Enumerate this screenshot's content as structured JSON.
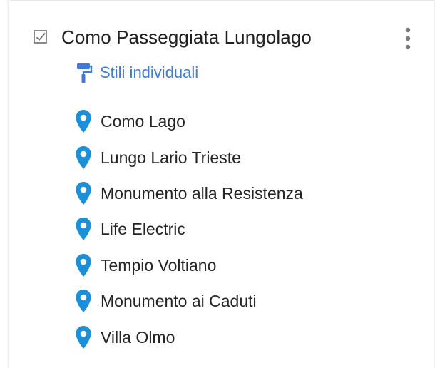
{
  "layer": {
    "title": "Como Passeggiata Lungolago",
    "checked": true,
    "checkbox_icon": "checkbox-checked-icon",
    "menu_icon": "more-vert-icon"
  },
  "styles": {
    "label": "Stili individuali",
    "icon": "paint-roller-icon"
  },
  "places": [
    {
      "label": "Como Lago",
      "icon": "map-pin-icon"
    },
    {
      "label": "Lungo Lario Trieste",
      "icon": "map-pin-icon"
    },
    {
      "label": "Monumento alla Resistenza",
      "icon": "map-pin-icon"
    },
    {
      "label": "Life Electric",
      "icon": "map-pin-icon"
    },
    {
      "label": "Tempio Voltiano",
      "icon": "map-pin-icon"
    },
    {
      "label": "Monumento ai Caduti",
      "icon": "map-pin-icon"
    },
    {
      "label": "Villa Olmo",
      "icon": "map-pin-icon"
    }
  ],
  "colors": {
    "pin": "#1b8fd8",
    "link": "#3e7ad6",
    "text": "#242424",
    "menu_dots": "#7b7b7b",
    "checkbox": "#6d6d6d"
  }
}
